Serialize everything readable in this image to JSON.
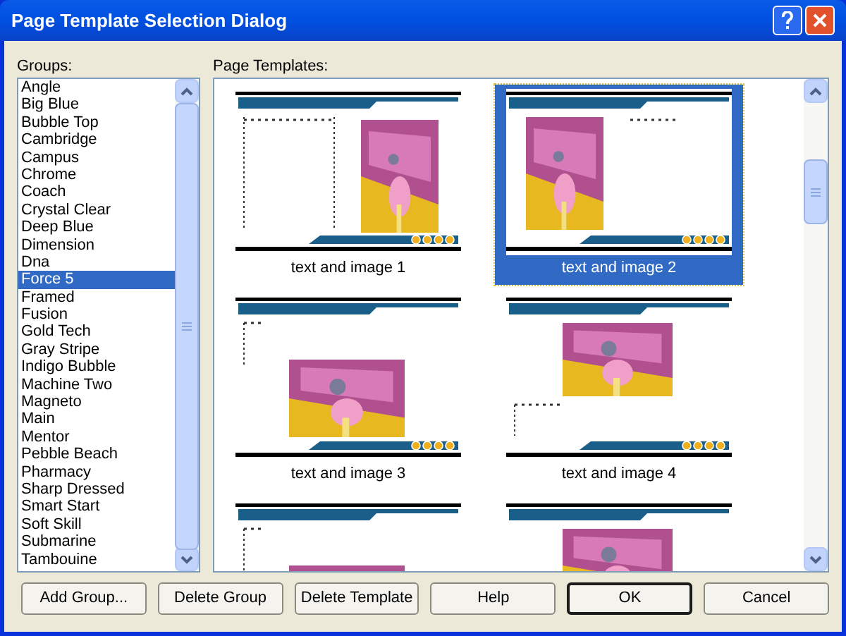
{
  "window": {
    "title": "Page Template Selection Dialog"
  },
  "groups": {
    "label": "Groups:",
    "items": [
      {
        "label": "Angle",
        "selected": false
      },
      {
        "label": "Big Blue",
        "selected": false
      },
      {
        "label": "Bubble Top",
        "selected": false
      },
      {
        "label": "Cambridge",
        "selected": false
      },
      {
        "label": "Campus",
        "selected": false
      },
      {
        "label": "Chrome",
        "selected": false
      },
      {
        "label": "Coach",
        "selected": false
      },
      {
        "label": "Crystal Clear",
        "selected": false
      },
      {
        "label": "Deep Blue",
        "selected": false
      },
      {
        "label": "Dimension",
        "selected": false
      },
      {
        "label": "Dna",
        "selected": false
      },
      {
        "label": "Force 5",
        "selected": true
      },
      {
        "label": "Framed",
        "selected": false
      },
      {
        "label": "Fusion",
        "selected": false
      },
      {
        "label": "Gold Tech",
        "selected": false
      },
      {
        "label": "Gray Stripe",
        "selected": false
      },
      {
        "label": "Indigo Bubble",
        "selected": false
      },
      {
        "label": "Machine Two",
        "selected": false
      },
      {
        "label": "Magneto",
        "selected": false
      },
      {
        "label": "Main",
        "selected": false
      },
      {
        "label": "Mentor",
        "selected": false
      },
      {
        "label": "Pebble Beach",
        "selected": false
      },
      {
        "label": "Pharmacy",
        "selected": false
      },
      {
        "label": "Sharp Dressed",
        "selected": false
      },
      {
        "label": "Smart Start",
        "selected": false
      },
      {
        "label": "Soft Skill",
        "selected": false
      },
      {
        "label": "Submarine",
        "selected": false
      },
      {
        "label": "Tambouine",
        "selected": false
      }
    ]
  },
  "templates": {
    "label": "Page Templates:",
    "items": [
      {
        "kind": "text-left",
        "label": "text and image 1",
        "selected": false
      },
      {
        "kind": "text-right",
        "label": "text and image 2",
        "selected": true
      },
      {
        "kind": "image-low",
        "label": "text and image 3",
        "selected": false
      },
      {
        "kind": "image-high",
        "label": "text and image 4",
        "selected": false
      },
      {
        "kind": "image-low",
        "selected": false
      },
      {
        "kind": "image-high",
        "selected": false
      }
    ]
  },
  "buttons": [
    {
      "label": "Add Group...",
      "default": false
    },
    {
      "label": "Delete Group",
      "default": false
    },
    {
      "label": "Delete Template",
      "default": false
    },
    {
      "label": "Help",
      "default": false
    },
    {
      "label": "OK",
      "default": true
    },
    {
      "label": "Cancel",
      "default": false
    }
  ]
}
